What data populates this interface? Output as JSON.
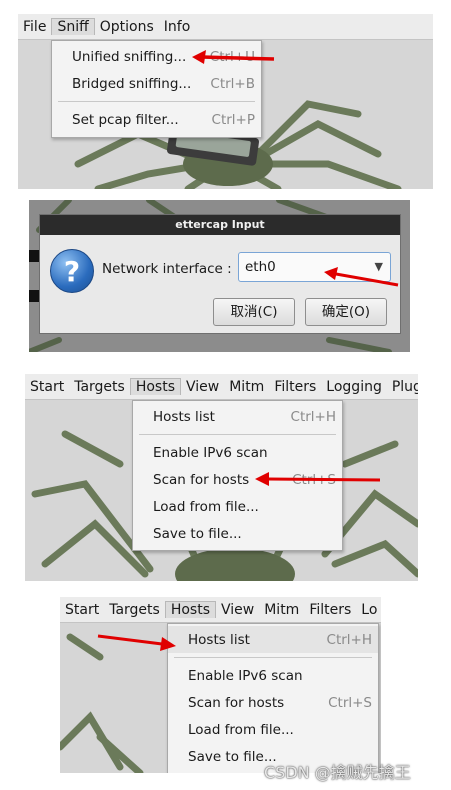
{
  "panel1": {
    "menubar": [
      "File",
      "Sniff",
      "Options",
      "Info"
    ],
    "menu": [
      {
        "label": "Unified sniffing...",
        "accel": "Ctrl+U"
      },
      {
        "label": "Bridged sniffing...",
        "accel": "Ctrl+B"
      },
      {
        "label": "Set pcap filter...",
        "accel": "Ctrl+P"
      }
    ]
  },
  "dialog": {
    "title": "ettercap Input",
    "icon_glyph": "?",
    "label": "Network interface :",
    "interface_value": "eth0",
    "dropdown_glyph": "▼",
    "cancel_label": "取消(C)",
    "ok_label": "确定(O)"
  },
  "panel3": {
    "menubar": [
      "Start",
      "Targets",
      "Hosts",
      "View",
      "Mitm",
      "Filters",
      "Logging",
      "Plug"
    ],
    "menu": [
      {
        "label": "Hosts list",
        "accel": "Ctrl+H"
      },
      {
        "label": "Enable IPv6 scan",
        "accel": ""
      },
      {
        "label": "Scan for hosts",
        "accel": "Ctrl+S"
      },
      {
        "label": "Load from file...",
        "accel": ""
      },
      {
        "label": "Save to file...",
        "accel": ""
      }
    ]
  },
  "panel4": {
    "menubar": [
      "Start",
      "Targets",
      "Hosts",
      "View",
      "Mitm",
      "Filters",
      "Lo"
    ],
    "menu": [
      {
        "label": "Hosts list",
        "accel": "Ctrl+H"
      },
      {
        "label": "Enable IPv6 scan",
        "accel": ""
      },
      {
        "label": "Scan for hosts",
        "accel": "Ctrl+S"
      },
      {
        "label": "Load from file...",
        "accel": ""
      },
      {
        "label": "Save to file...",
        "accel": ""
      }
    ]
  },
  "watermark": "CSDN @擒贼先擒王",
  "colors": {
    "annotation_arrow": "#e00000",
    "menu_bg": "#f3f3f3",
    "dialog_title_bg": "#2b2b2b"
  },
  "icons": [
    "question-icon",
    "dropdown-arrow-icon",
    "red-annotation-arrow"
  ]
}
